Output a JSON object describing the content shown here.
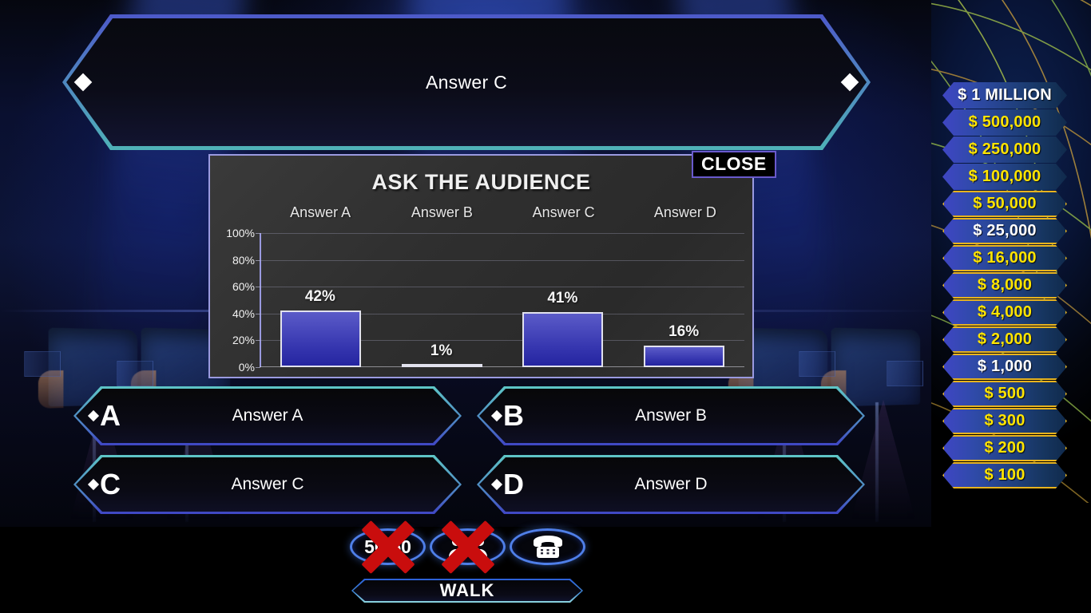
{
  "question": {
    "text": "Answer C"
  },
  "answers": [
    {
      "letter": "A",
      "text": "Answer A"
    },
    {
      "letter": "B",
      "text": "Answer B"
    },
    {
      "letter": "C",
      "text": "Answer C"
    },
    {
      "letter": "D",
      "text": "Answer D"
    }
  ],
  "audience_panel": {
    "title": "ASK THE AUDIENCE",
    "close_label": "CLOSE"
  },
  "chart_data": {
    "type": "bar",
    "title": "ASK THE AUDIENCE",
    "categories": [
      "Answer A",
      "Answer B",
      "Answer C",
      "Answer D"
    ],
    "values": [
      42,
      1,
      41,
      16
    ],
    "value_labels": [
      "42%",
      "1%",
      "41%",
      "16%"
    ],
    "ytick_labels": [
      "100%",
      "80%",
      "60%",
      "40%",
      "20%",
      "0%"
    ],
    "yticks": [
      100,
      80,
      60,
      40,
      20,
      0
    ],
    "ylim": [
      0,
      100
    ],
    "xlabel": "",
    "ylabel": "",
    "grid": true,
    "legend": "none",
    "bar_color": "#3a3ab4",
    "panel_background": "#2f2f2f"
  },
  "lifelines": [
    {
      "name": "50:50",
      "label": "50:50",
      "icon": "fifty-fifty-icon",
      "used": true
    },
    {
      "name": "ask-the-audience",
      "label": "",
      "icon": "audience-icon",
      "used": true
    },
    {
      "name": "phone-a-friend",
      "label": "",
      "icon": "telephone-icon",
      "used": false
    }
  ],
  "walk": {
    "label": "WALK"
  },
  "ladder": {
    "rows": [
      {
        "amount": "$ 1 MILLION",
        "style": "top"
      },
      {
        "amount": "$ 500,000",
        "style": "plain"
      },
      {
        "amount": "$ 250,000",
        "style": "plain"
      },
      {
        "amount": "$ 100,000",
        "style": "plain"
      },
      {
        "amount": "$ 50,000",
        "style": "gold"
      },
      {
        "amount": "$ 25,000",
        "style": "gold-safe"
      },
      {
        "amount": "$ 16,000",
        "style": "gold"
      },
      {
        "amount": "$ 8,000",
        "style": "gold"
      },
      {
        "amount": "$ 4,000",
        "style": "gold"
      },
      {
        "amount": "$ 2,000",
        "style": "gold"
      },
      {
        "amount": "$ 1,000",
        "style": "gold-safe"
      },
      {
        "amount": "$ 500",
        "style": "gold"
      },
      {
        "amount": "$ 300",
        "style": "gold"
      },
      {
        "amount": "$ 200",
        "style": "gold"
      },
      {
        "amount": "$ 100",
        "style": "gold"
      }
    ]
  },
  "colors": {
    "money_text": "#ffe400",
    "safe_text": "#ffffff",
    "gold_border": "#e8b31d",
    "accent_blue": "#4f7fe8",
    "frame_teal": "#5ec6c6",
    "red_x": "#c90d0d"
  }
}
